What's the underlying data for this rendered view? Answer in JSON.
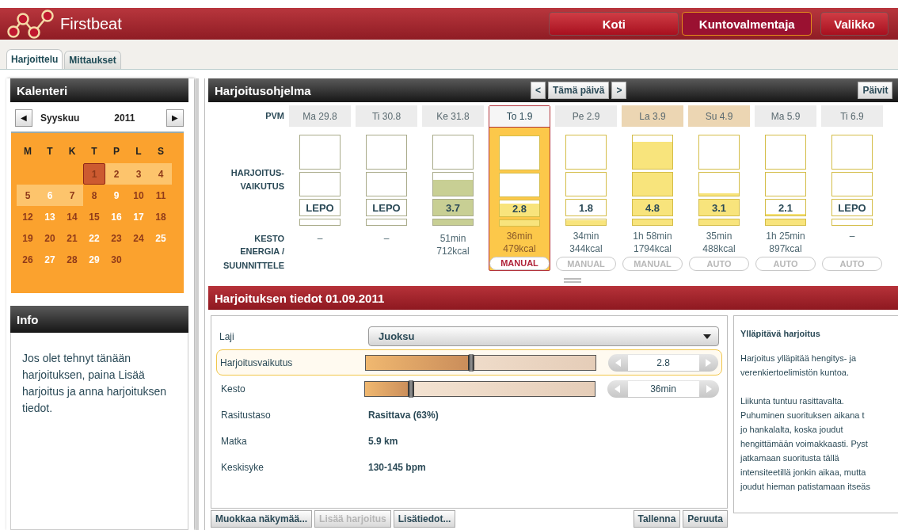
{
  "header": {
    "brand": "Firstbeat",
    "nav": [
      {
        "label": "Koti",
        "selected": false
      },
      {
        "label": "Kuntovalmentaja",
        "selected": true
      },
      {
        "label": "Valikko",
        "selected": false
      }
    ]
  },
  "tabs": [
    {
      "label": "Harjoittelu",
      "selected": true
    },
    {
      "label": "Mittaukset",
      "selected": false
    }
  ],
  "calendar": {
    "title": "Kalenteri",
    "prev": "◀",
    "month": "Syyskuu",
    "year": "2011",
    "next": "▶",
    "weekdays": [
      "M",
      "T",
      "K",
      "T",
      "P",
      "L",
      "S"
    ],
    "weeks": [
      [
        {
          "day": "1",
          "marked": false,
          "in_range": true,
          "selected": true
        },
        {
          "day": "2",
          "marked": false,
          "in_range": true,
          "selected": false
        },
        {
          "day": "3",
          "marked": false,
          "in_range": true,
          "selected": false
        },
        {
          "day": "4",
          "marked": false,
          "in_range": true,
          "selected": false
        }
      ],
      [
        {
          "day": "5",
          "marked": false,
          "in_range": true,
          "selected": false
        },
        {
          "day": "6",
          "marked": true,
          "in_range": true,
          "selected": false
        },
        {
          "day": "7",
          "marked": false,
          "in_range": true,
          "selected": false
        },
        {
          "day": "8",
          "marked": false,
          "in_range": false,
          "selected": false
        },
        {
          "day": "9",
          "marked": true,
          "in_range": false,
          "selected": false
        },
        {
          "day": "10",
          "marked": false,
          "in_range": false,
          "selected": false
        },
        {
          "day": "11",
          "marked": false,
          "in_range": false,
          "selected": false
        }
      ],
      [
        {
          "day": "12",
          "marked": false,
          "in_range": false,
          "selected": false
        },
        {
          "day": "13",
          "marked": true,
          "in_range": false,
          "selected": false
        },
        {
          "day": "14",
          "marked": false,
          "in_range": false,
          "selected": false
        },
        {
          "day": "15",
          "marked": false,
          "in_range": false,
          "selected": false
        },
        {
          "day": "16",
          "marked": true,
          "in_range": false,
          "selected": false
        },
        {
          "day": "17",
          "marked": true,
          "in_range": false,
          "selected": false
        },
        {
          "day": "18",
          "marked": false,
          "in_range": false,
          "selected": false
        }
      ],
      [
        {
          "day": "19",
          "marked": false,
          "in_range": false,
          "selected": false
        },
        {
          "day": "20",
          "marked": false,
          "in_range": false,
          "selected": false
        },
        {
          "day": "21",
          "marked": false,
          "in_range": false,
          "selected": false
        },
        {
          "day": "22",
          "marked": true,
          "in_range": false,
          "selected": false
        },
        {
          "day": "23",
          "marked": false,
          "in_range": false,
          "selected": false
        },
        {
          "day": "24",
          "marked": false,
          "in_range": false,
          "selected": false
        },
        {
          "day": "25",
          "marked": true,
          "in_range": false,
          "selected": false
        }
      ],
      [
        {
          "day": "26",
          "marked": false,
          "in_range": false,
          "selected": false
        },
        {
          "day": "27",
          "marked": true,
          "in_range": false,
          "selected": false
        },
        {
          "day": "28",
          "marked": false,
          "in_range": false,
          "selected": false
        },
        {
          "day": "29",
          "marked": true,
          "in_range": false,
          "selected": false
        },
        {
          "day": "30",
          "marked": false,
          "in_range": false,
          "selected": false
        }
      ]
    ]
  },
  "info": {
    "title": "Info",
    "text": "Jos olet tehnyt tänään harjoituksen, paina Lisää harjoitus ja anna harjoituksen tiedot."
  },
  "program": {
    "title": "Harjoitusohjelma",
    "prev": "<",
    "today": "Tämä päivä",
    "next": ">",
    "refresh": "Päivit",
    "labels": {
      "date": "PVM",
      "effect": "HARJOITUS- VAIKUTUS",
      "duration": "KESTO",
      "energy": "ENERGIA /",
      "plan": "SUUNNITTELE"
    },
    "days": [
      {
        "date": "Ma 29.8",
        "weekend": false,
        "selected": false,
        "kind": "past",
        "value": "LEPO",
        "duration": "–"
      },
      {
        "date": "Ti 30.8",
        "weekend": false,
        "selected": false,
        "kind": "past",
        "value": "LEPO",
        "duration": "–"
      },
      {
        "date": "Ke 31.8",
        "weekend": false,
        "selected": false,
        "kind": "past",
        "value": "3.7",
        "duration": "51min",
        "energy": "712kcal"
      },
      {
        "date": "To 1.9",
        "weekend": false,
        "selected": true,
        "kind": "future",
        "value": "2.8",
        "duration": "36min",
        "energy": "479kcal",
        "mode": "MANUAL"
      },
      {
        "date": "Pe 2.9",
        "weekend": false,
        "selected": false,
        "kind": "future",
        "value": "1.8",
        "duration": "34min",
        "energy": "344kcal",
        "mode": "MANUAL"
      },
      {
        "date": "La 3.9",
        "weekend": true,
        "selected": false,
        "kind": "future",
        "value": "4.8",
        "duration": "1h 58min",
        "energy": "1794kcal",
        "mode": "MANUAL"
      },
      {
        "date": "Su 4.9",
        "weekend": true,
        "selected": false,
        "kind": "future",
        "value": "3.1",
        "duration": "35min",
        "energy": "488kcal",
        "mode": "AUTO"
      },
      {
        "date": "Ma 5.9",
        "weekend": false,
        "selected": false,
        "kind": "future",
        "value": "2.1",
        "duration": "1h 25min",
        "energy": "897kcal",
        "mode": "AUTO"
      },
      {
        "date": "Ti 6.9",
        "weekend": false,
        "selected": false,
        "kind": "future",
        "value": "LEPO",
        "duration": "–",
        "mode": "AUTO"
      }
    ]
  },
  "details": {
    "title": "Harjoituksen tiedot 01.09.2011",
    "fields": [
      {
        "kind": "select",
        "label": "Laji",
        "value": "Juoksu",
        "highlighted": false
      },
      {
        "kind": "slider",
        "label": "Harjoitusvaikutus",
        "level": 0.46,
        "value": "2.8",
        "highlighted": true
      },
      {
        "kind": "slider",
        "label": "Kesto",
        "level": 0.2,
        "value": "36min",
        "highlighted": false
      },
      {
        "kind": "text",
        "label": "Rasitustaso",
        "value": "Rasittava (63%)",
        "highlighted": false
      },
      {
        "kind": "text",
        "label": "Matka",
        "value": "5.9 km",
        "highlighted": false
      },
      {
        "kind": "text",
        "label": "Keskisyke",
        "value": "130-145 bpm",
        "highlighted": false
      }
    ],
    "buttons_left": [
      {
        "label": "Muokkaa näkymää...",
        "disabled": false
      },
      {
        "label": "Lisää harjoitus",
        "disabled": true
      },
      {
        "label": "Lisätiedot...",
        "disabled": false
      }
    ],
    "buttons_right": [
      {
        "label": "Tallenna",
        "disabled": false
      },
      {
        "label": "Peruuta",
        "disabled": false
      }
    ],
    "description": {
      "title": "Ylläpitävä harjoitus",
      "paragraphs": [
        [
          "Harjoitus ylläpitää hengitys- ja",
          "verenkiertoelimistön kuntoa."
        ],
        [
          "Liikunta tuntuu rasittavalta.",
          "Puhuminen suorituksen aikana t",
          "jo hankalalta, koska joudut",
          "hengittämään voimakkaasti. Pyst",
          "jatkamaan suoritusta tällä",
          "intensiteetillä jonkin aikaa, mutta",
          "joudut hieman patistamaan itseäs"
        ]
      ]
    }
  }
}
